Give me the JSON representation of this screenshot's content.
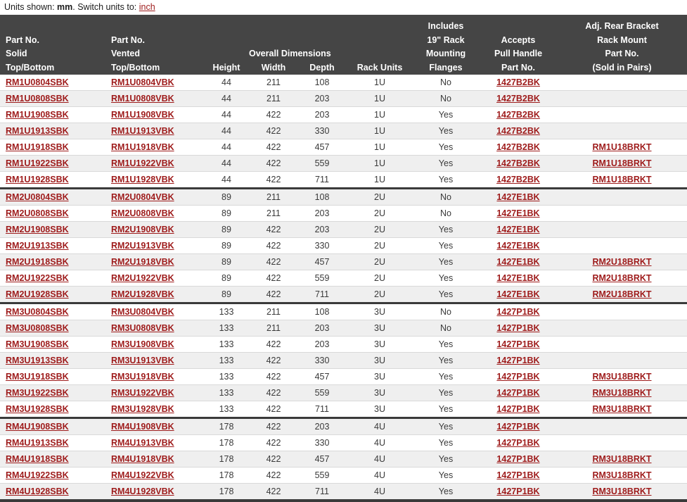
{
  "units_bar": {
    "prefix": "Units shown: ",
    "current_unit": "mm",
    "middle": ". Switch units to: ",
    "switch_link": "inch"
  },
  "colors": {
    "header_bg": "#454545",
    "link": "#9e1b1b",
    "row_shaded": "#efefef",
    "row_plain": "#ffffff",
    "rule": "#3a3a3a"
  },
  "table": {
    "columns": [
      {
        "key": "solid",
        "lines": [
          "Part No.",
          "Solid",
          "Top/Bottom"
        ],
        "align": "left"
      },
      {
        "key": "vented",
        "lines": [
          "Part No.",
          "Vented",
          "Top/Bottom"
        ],
        "align": "left"
      },
      {
        "key": "height",
        "group": "Overall Dimensions",
        "lines": [
          "Height"
        ],
        "align": "center"
      },
      {
        "key": "width",
        "group": "Overall Dimensions",
        "lines": [
          "Width"
        ],
        "align": "center"
      },
      {
        "key": "depth",
        "group": "Overall Dimensions",
        "lines": [
          "Depth"
        ],
        "align": "center"
      },
      {
        "key": "rack_units",
        "lines": [
          "Rack Units"
        ],
        "align": "center"
      },
      {
        "key": "flanges",
        "lines": [
          "Includes",
          "19\" Rack",
          "Mounting",
          "Flanges"
        ],
        "align": "center"
      },
      {
        "key": "handle",
        "lines": [
          "Accepts",
          "Pull Handle",
          "Part No."
        ],
        "align": "center"
      },
      {
        "key": "bracket",
        "lines": [
          "Adj. Rear Bracket",
          "Rack Mount",
          "Part No.",
          "(Sold in Pairs)"
        ],
        "align": "center"
      }
    ],
    "header_labels": {
      "part_no": "Part No.",
      "solid": "Solid",
      "vented": "Vented",
      "top_bottom": "Top/Bottom",
      "overall_dimensions": "Overall Dimensions",
      "height": "Height",
      "width": "Width",
      "depth": "Depth",
      "rack_units": "Rack Units",
      "includes": "Includes",
      "rack_19": "19\" Rack",
      "mounting": "Mounting",
      "flanges": "Flanges",
      "accepts": "Accepts",
      "pull_handle": "Pull Handle",
      "handle_part_no": "Part No.",
      "adj_rear_bracket": "Adj. Rear Bracket",
      "rack_mount": "Rack Mount",
      "bracket_part_no": "Part No.",
      "sold_in_pairs": "(Sold in Pairs)"
    },
    "groups": [
      {
        "name": "1U",
        "rows": [
          {
            "solid": "RM1U0804SBK",
            "vented": "RM1U0804VBK",
            "height": "44",
            "width": "211",
            "depth": "108",
            "rack_units": "1U",
            "flanges": "No",
            "handle": "1427B2BK",
            "bracket": ""
          },
          {
            "solid": "RM1U0808SBK",
            "vented": "RM1U0808VBK",
            "height": "44",
            "width": "211",
            "depth": "203",
            "rack_units": "1U",
            "flanges": "No",
            "handle": "1427B2BK",
            "bracket": ""
          },
          {
            "solid": "RM1U1908SBK",
            "vented": "RM1U1908VBK",
            "height": "44",
            "width": "422",
            "depth": "203",
            "rack_units": "1U",
            "flanges": "Yes",
            "handle": "1427B2BK",
            "bracket": ""
          },
          {
            "solid": "RM1U1913SBK",
            "vented": "RM1U1913VBK",
            "height": "44",
            "width": "422",
            "depth": "330",
            "rack_units": "1U",
            "flanges": "Yes",
            "handle": "1427B2BK",
            "bracket": ""
          },
          {
            "solid": "RM1U1918SBK",
            "vented": "RM1U1918VBK",
            "height": "44",
            "width": "422",
            "depth": "457",
            "rack_units": "1U",
            "flanges": "Yes",
            "handle": "1427B2BK",
            "bracket": "RM1U18BRKT"
          },
          {
            "solid": "RM1U1922SBK",
            "vented": "RM1U1922VBK",
            "height": "44",
            "width": "422",
            "depth": "559",
            "rack_units": "1U",
            "flanges": "Yes",
            "handle": "1427B2BK",
            "bracket": "RM1U18BRKT"
          },
          {
            "solid": "RM1U1928SBK",
            "vented": "RM1U1928VBK",
            "height": "44",
            "width": "422",
            "depth": "711",
            "rack_units": "1U",
            "flanges": "Yes",
            "handle": "1427B2BK",
            "bracket": "RM1U18BRKT"
          }
        ]
      },
      {
        "name": "2U",
        "rows": [
          {
            "solid": "RM2U0804SBK",
            "vented": "RM2U0804VBK",
            "height": "89",
            "width": "211",
            "depth": "108",
            "rack_units": "2U",
            "flanges": "No",
            "handle": "1427E1BK",
            "bracket": ""
          },
          {
            "solid": "RM2U0808SBK",
            "vented": "RM2U0808VBK",
            "height": "89",
            "width": "211",
            "depth": "203",
            "rack_units": "2U",
            "flanges": "No",
            "handle": "1427E1BK",
            "bracket": ""
          },
          {
            "solid": "RM2U1908SBK",
            "vented": "RM2U1908VBK",
            "height": "89",
            "width": "422",
            "depth": "203",
            "rack_units": "2U",
            "flanges": "Yes",
            "handle": "1427E1BK",
            "bracket": ""
          },
          {
            "solid": "RM2U1913SBK",
            "vented": "RM2U1913VBK",
            "height": "89",
            "width": "422",
            "depth": "330",
            "rack_units": "2U",
            "flanges": "Yes",
            "handle": "1427E1BK",
            "bracket": ""
          },
          {
            "solid": "RM2U1918SBK",
            "vented": "RM2U1918VBK",
            "height": "89",
            "width": "422",
            "depth": "457",
            "rack_units": "2U",
            "flanges": "Yes",
            "handle": "1427E1BK",
            "bracket": "RM2U18BRKT"
          },
          {
            "solid": "RM2U1922SBK",
            "vented": "RM2U1922VBK",
            "height": "89",
            "width": "422",
            "depth": "559",
            "rack_units": "2U",
            "flanges": "Yes",
            "handle": "1427E1BK",
            "bracket": "RM2U18BRKT"
          },
          {
            "solid": "RM2U1928SBK",
            "vented": "RM2U1928VBK",
            "height": "89",
            "width": "422",
            "depth": "711",
            "rack_units": "2U",
            "flanges": "Yes",
            "handle": "1427E1BK",
            "bracket": "RM2U18BRKT"
          }
        ]
      },
      {
        "name": "3U",
        "rows": [
          {
            "solid": "RM3U0804SBK",
            "vented": "RM3U0804VBK",
            "height": "133",
            "width": "211",
            "depth": "108",
            "rack_units": "3U",
            "flanges": "No",
            "handle": "1427P1BK",
            "bracket": ""
          },
          {
            "solid": "RM3U0808SBK",
            "vented": "RM3U0808VBK",
            "height": "133",
            "width": "211",
            "depth": "203",
            "rack_units": "3U",
            "flanges": "No",
            "handle": "1427P1BK",
            "bracket": ""
          },
          {
            "solid": "RM3U1908SBK",
            "vented": "RM3U1908VBK",
            "height": "133",
            "width": "422",
            "depth": "203",
            "rack_units": "3U",
            "flanges": "Yes",
            "handle": "1427P1BK",
            "bracket": ""
          },
          {
            "solid": "RM3U1913SBK",
            "vented": "RM3U1913VBK",
            "height": "133",
            "width": "422",
            "depth": "330",
            "rack_units": "3U",
            "flanges": "Yes",
            "handle": "1427P1BK",
            "bracket": ""
          },
          {
            "solid": "RM3U1918SBK",
            "vented": "RM3U1918VBK",
            "height": "133",
            "width": "422",
            "depth": "457",
            "rack_units": "3U",
            "flanges": "Yes",
            "handle": "1427P1BK",
            "bracket": "RM3U18BRKT"
          },
          {
            "solid": "RM3U1922SBK",
            "vented": "RM3U1922VBK",
            "height": "133",
            "width": "422",
            "depth": "559",
            "rack_units": "3U",
            "flanges": "Yes",
            "handle": "1427P1BK",
            "bracket": "RM3U18BRKT"
          },
          {
            "solid": "RM3U1928SBK",
            "vented": "RM3U1928VBK",
            "height": "133",
            "width": "422",
            "depth": "711",
            "rack_units": "3U",
            "flanges": "Yes",
            "handle": "1427P1BK",
            "bracket": "RM3U18BRKT"
          }
        ]
      },
      {
        "name": "4U",
        "rows": [
          {
            "solid": "RM4U1908SBK",
            "vented": "RM4U1908VBK",
            "height": "178",
            "width": "422",
            "depth": "203",
            "rack_units": "4U",
            "flanges": "Yes",
            "handle": "1427P1BK",
            "bracket": ""
          },
          {
            "solid": "RM4U1913SBK",
            "vented": "RM4U1913VBK",
            "height": "178",
            "width": "422",
            "depth": "330",
            "rack_units": "4U",
            "flanges": "Yes",
            "handle": "1427P1BK",
            "bracket": ""
          },
          {
            "solid": "RM4U1918SBK",
            "vented": "RM4U1918VBK",
            "height": "178",
            "width": "422",
            "depth": "457",
            "rack_units": "4U",
            "flanges": "Yes",
            "handle": "1427P1BK",
            "bracket": "RM3U18BRKT"
          },
          {
            "solid": "RM4U1922SBK",
            "vented": "RM4U1922VBK",
            "height": "178",
            "width": "422",
            "depth": "559",
            "rack_units": "4U",
            "flanges": "Yes",
            "handle": "1427P1BK",
            "bracket": "RM3U18BRKT"
          },
          {
            "solid": "RM4U1928SBK",
            "vented": "RM4U1928VBK",
            "height": "178",
            "width": "422",
            "depth": "711",
            "rack_units": "4U",
            "flanges": "Yes",
            "handle": "1427P1BK",
            "bracket": "RM3U18BRKT"
          }
        ]
      }
    ]
  }
}
